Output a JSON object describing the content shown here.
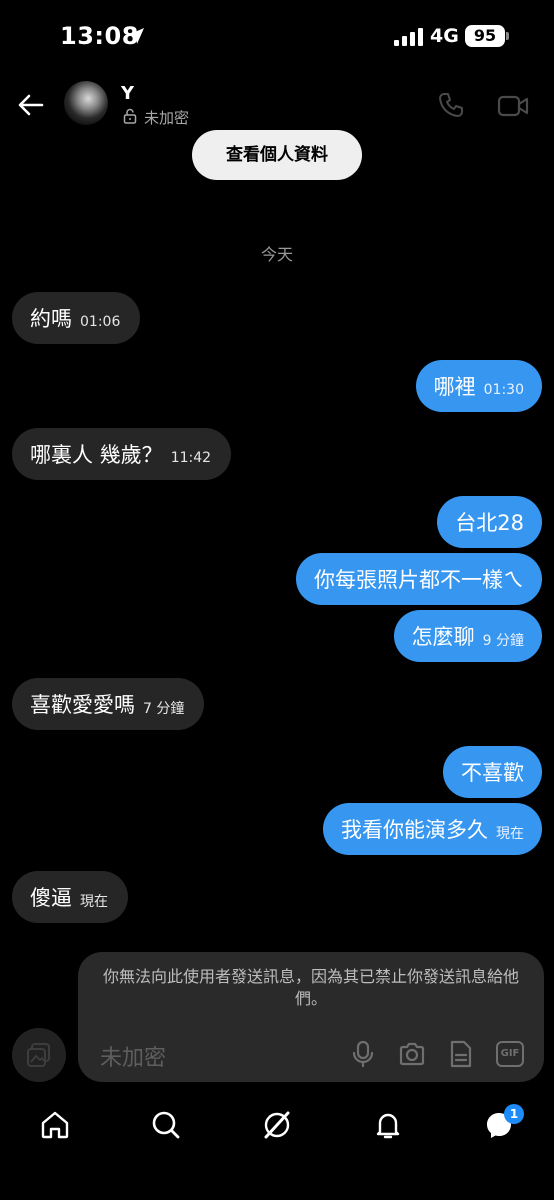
{
  "status_bar": {
    "time": "13:08",
    "network": "4G",
    "battery": "95"
  },
  "header": {
    "name": "Y",
    "encryption": "未加密"
  },
  "profile_button": "查看個人資料",
  "date_label": "今天",
  "messages": [
    {
      "dir": "recv",
      "text": "約嗎",
      "time": "01:06"
    },
    {
      "dir": "sent",
      "text": "哪裡",
      "time": "01:30"
    },
    {
      "dir": "recv",
      "text": "哪裏人 幾歲？",
      "time": "11:42"
    },
    {
      "dir": "sent",
      "text": "台北28",
      "time": ""
    },
    {
      "dir": "sent",
      "text": "你每張照片都不一樣ㄟ",
      "time": ""
    },
    {
      "dir": "sent",
      "text": "怎麼聊",
      "time": "9 分鐘"
    },
    {
      "dir": "recv",
      "text": "喜歡愛愛嗎",
      "time": "7 分鐘"
    },
    {
      "dir": "sent",
      "text": "不喜歡",
      "time": ""
    },
    {
      "dir": "sent",
      "text": "我看你能演多久",
      "time": "現在"
    },
    {
      "dir": "recv",
      "text": "傻逼",
      "time": "現在"
    }
  ],
  "notice": "你無法向此使用者發送訊息，因為其已禁止你發送訊息給他們。",
  "composer": {
    "placeholder": "未加密",
    "gif_label": "GIF"
  },
  "tabbar": {
    "messages_badge": "1"
  },
  "colors": {
    "sent_bubble": "#3797f0",
    "recv_bubble": "#262626",
    "background": "#000000"
  }
}
